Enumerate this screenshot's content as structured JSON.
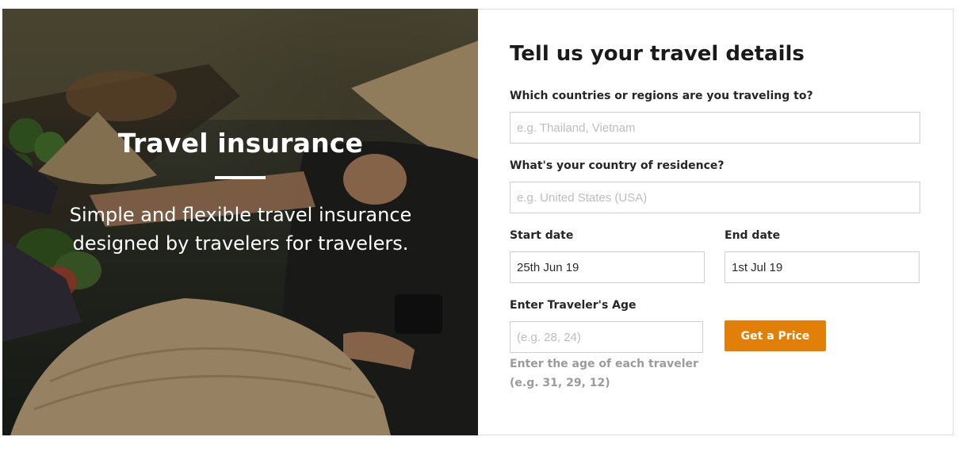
{
  "hero": {
    "title": "Travel insurance",
    "subtitle": "Simple and flexible travel insurance designed by travelers for travelers."
  },
  "form": {
    "title": "Tell us your travel details",
    "destination": {
      "label": "Which countries or regions are you traveling to?",
      "placeholder": "e.g. Thailand, Vietnam",
      "value": ""
    },
    "residence": {
      "label": "What's your country of residence?",
      "placeholder": "e.g. United States (USA)",
      "value": ""
    },
    "start_date": {
      "label": "Start date",
      "value": "25th Jun 19"
    },
    "end_date": {
      "label": "End date",
      "value": "1st Jul 19"
    },
    "age": {
      "label": "Enter Traveler's Age",
      "placeholder": "(e.g. 28, 24)",
      "value": "",
      "hint_line1": "Enter the age of each traveler",
      "hint_line2": "(e.g. 31, 29, 12)"
    },
    "submit_label": "Get a Price"
  },
  "colors": {
    "accent": "#e27f08",
    "border": "#cfcfcf",
    "hint": "#9b9b9b"
  }
}
